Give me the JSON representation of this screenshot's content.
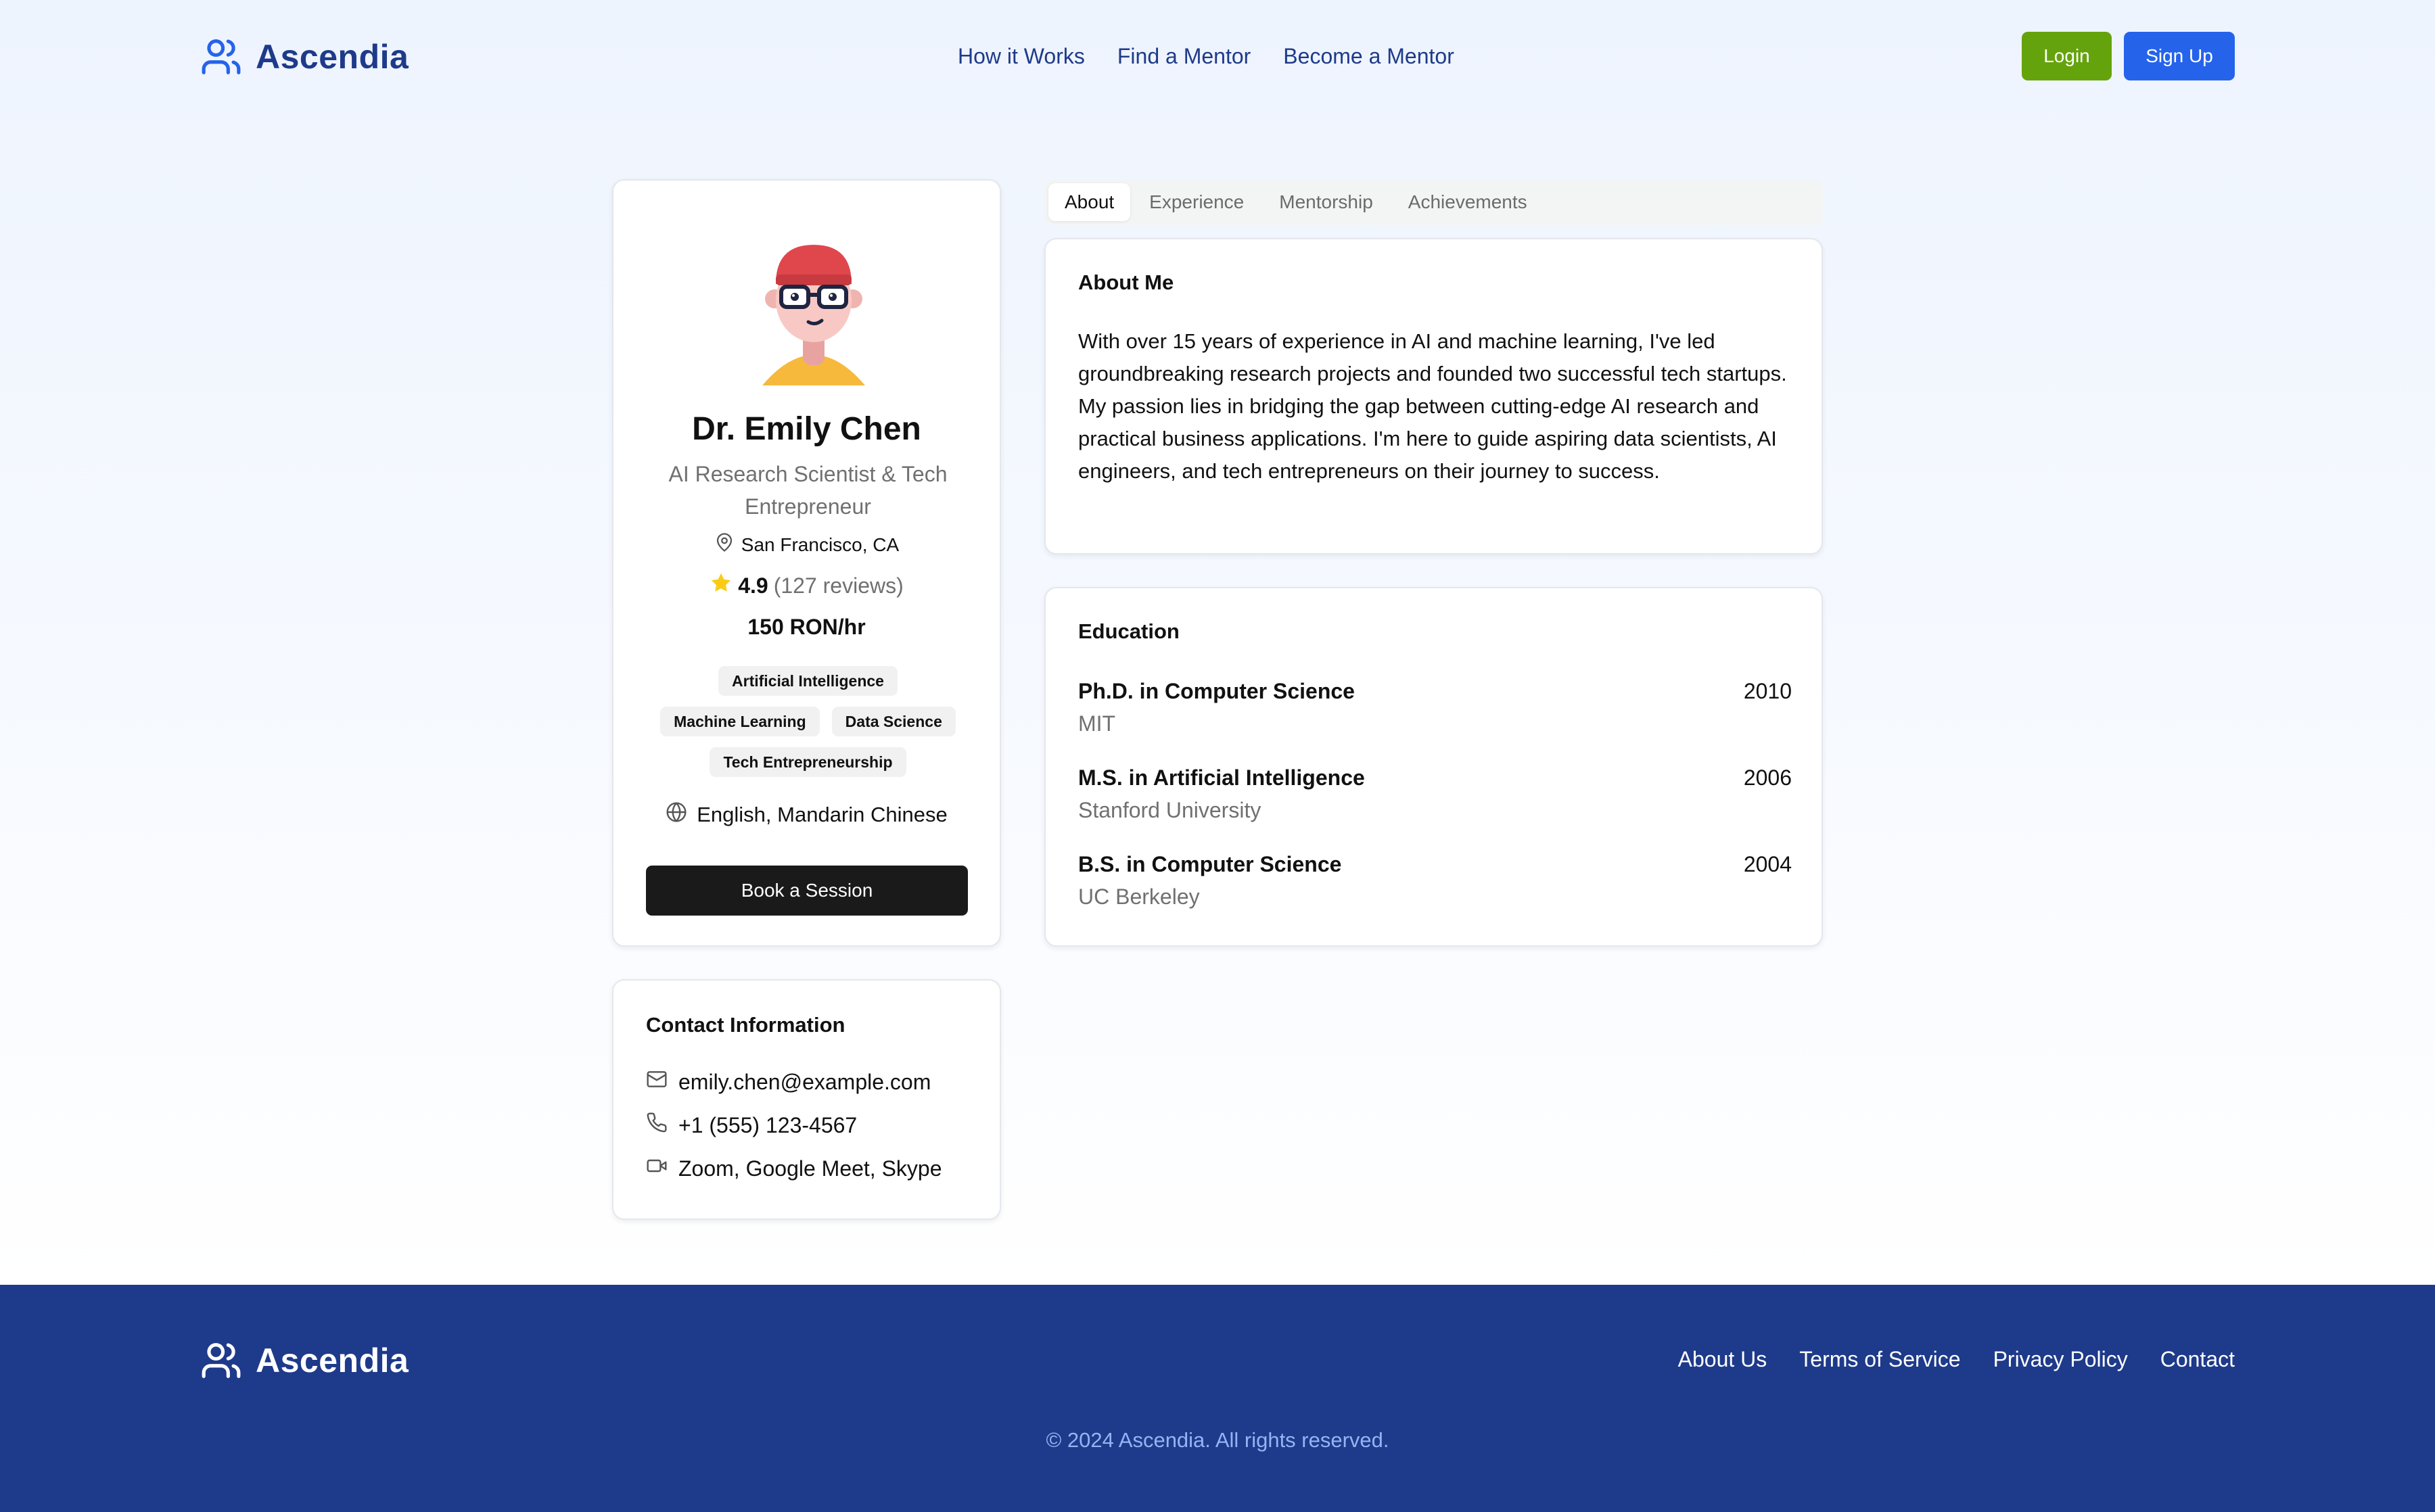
{
  "brand": {
    "name": "Ascendia",
    "icon": "users-icon",
    "color": "#1e3a8a"
  },
  "nav": {
    "items": [
      {
        "label": "How it Works"
      },
      {
        "label": "Find a Mentor"
      },
      {
        "label": "Become a Mentor"
      }
    ]
  },
  "auth": {
    "login_label": "Login",
    "login_color": "#65a30d",
    "signup_label": "Sign Up",
    "signup_color": "#2563eb"
  },
  "profile": {
    "name": "Dr. Emily Chen",
    "title": "AI Research Scientist & Tech Entrepreneur",
    "location": "San Francisco, CA",
    "rating": "4.9",
    "reviews": "(127 reviews)",
    "rate": "150 RON/hr",
    "tags": [
      "Artificial Intelligence",
      "Machine Learning",
      "Data Science",
      "Tech Entrepreneurship"
    ],
    "languages": "English, Mandarin Chinese",
    "book_label": "Book a Session"
  },
  "contact": {
    "heading": "Contact Information",
    "email": "emily.chen@example.com",
    "phone": "+1 (555) 123-4567",
    "platforms": "Zoom, Google Meet, Skype"
  },
  "tabs": [
    {
      "label": "About",
      "active": true
    },
    {
      "label": "Experience",
      "active": false
    },
    {
      "label": "Mentorship",
      "active": false
    },
    {
      "label": "Achievements",
      "active": false
    }
  ],
  "about": {
    "heading": "About Me",
    "text": "With over 15 years of experience in AI and machine learning, I've led groundbreaking research projects and founded two successful tech startups. My passion lies in bridging the gap between cutting-edge AI research and practical business applications. I'm here to guide aspiring data scientists, AI engineers, and tech entrepreneurs on their journey to success."
  },
  "education": {
    "heading": "Education",
    "items": [
      {
        "degree": "Ph.D. in Computer Science",
        "school": "MIT",
        "year": "2010"
      },
      {
        "degree": "M.S. in Artificial Intelligence",
        "school": "Stanford University",
        "year": "2006"
      },
      {
        "degree": "B.S. in Computer Science",
        "school": "UC Berkeley",
        "year": "2004"
      }
    ]
  },
  "footer": {
    "links": [
      {
        "label": "About Us"
      },
      {
        "label": "Terms of Service"
      },
      {
        "label": "Privacy Policy"
      },
      {
        "label": "Contact"
      }
    ],
    "copyright": "© 2024 Ascendia. All rights reserved.",
    "background": "#1e3a8a"
  }
}
